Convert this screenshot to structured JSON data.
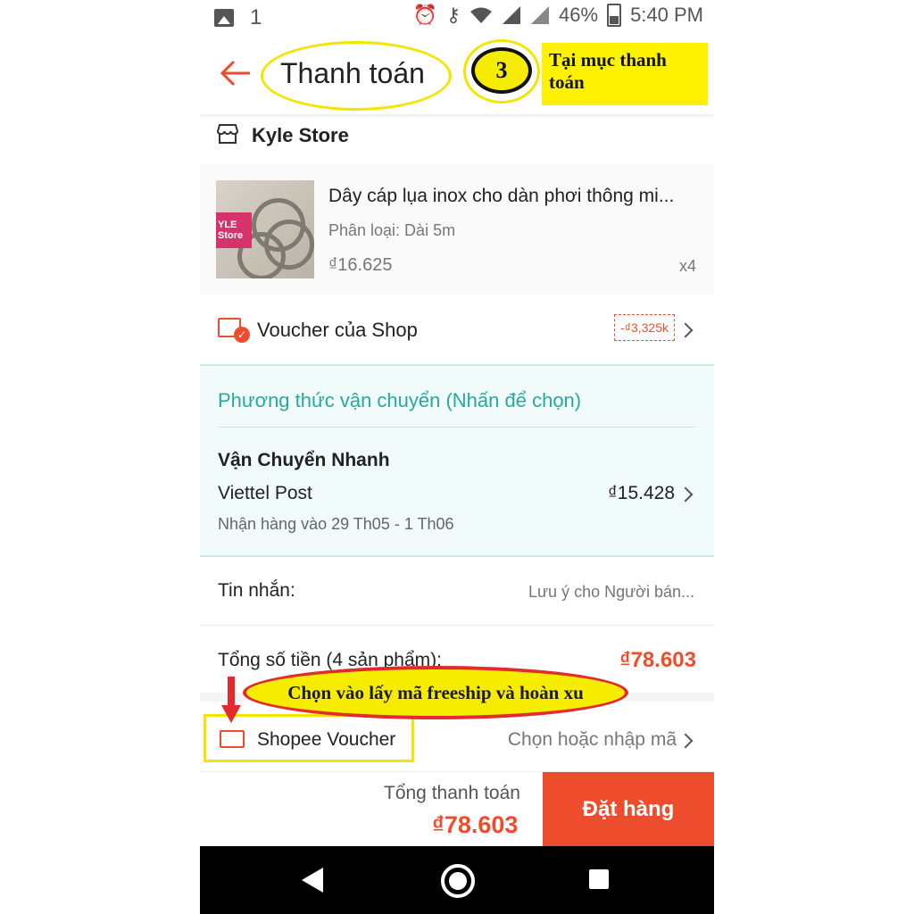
{
  "status_bar": {
    "left_number": "1",
    "battery_percent": "46%",
    "time": "5:40 PM"
  },
  "header": {
    "title": "Thanh toán",
    "step_number": "3",
    "step_note": "Tại mục thanh toán"
  },
  "store": {
    "name": "Kyle Store"
  },
  "product": {
    "name": "Dây cáp lụa inox cho dàn phơi thông mi...",
    "variant": "Phân loại: Dài 5m",
    "price": "₫16.625",
    "quantity": "x4",
    "thumb_tag": "YLE Store"
  },
  "shop_voucher": {
    "label": "Voucher của Shop",
    "badge": "-₫3,325k"
  },
  "shipping": {
    "section_title": "Phương thức vận chuyển (Nhấn để chọn)",
    "method_name": "Vận Chuyển Nhanh",
    "carrier": "Viettel Post",
    "fee": "₫15.428",
    "delivery_date": "Nhận hàng vào 29 Th05 - 1 Th06"
  },
  "message": {
    "label": "Tin nhắn:",
    "placeholder": "Lưu ý cho Người bán..."
  },
  "order_total": {
    "label": "Tổng số tiền (4 sản phẩm):",
    "value": "₫78.603"
  },
  "annotation": {
    "balloon_text": "Chọn vào lấy mã freeship và hoàn xu"
  },
  "shopee_voucher": {
    "label": "Shopee Voucher",
    "action": "Chọn hoặc nhập mã"
  },
  "bottom_bar": {
    "total_label": "Tổng thanh toán",
    "total_value": "₫78.603",
    "order_button": "Đặt hàng"
  },
  "colors": {
    "brand": "#ee4d2d",
    "teal": "#26aa99",
    "highlight_yellow": "#f5ec00"
  },
  "icons": [
    "image-icon",
    "alarm-icon",
    "key-icon",
    "wifi-icon",
    "signal-icon",
    "battery-icon",
    "back-arrow-icon",
    "store-icon",
    "voucher-icon",
    "chevron-right-icon",
    "nav-back-icon",
    "nav-home-icon",
    "nav-recent-icon"
  ]
}
